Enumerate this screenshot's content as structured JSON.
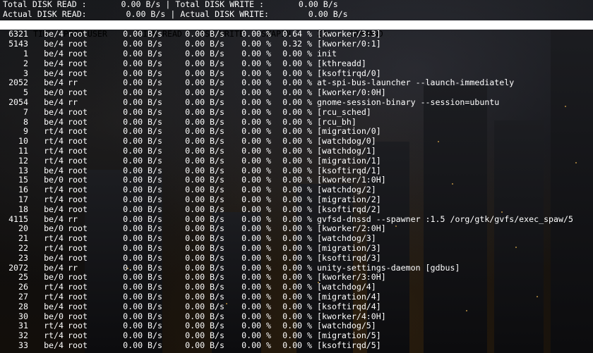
{
  "summary": {
    "total_read_label": "Total DISK READ :",
    "total_read_value": "0.00 B/s",
    "total_write_label": "Total DISK WRITE :",
    "total_write_value": "0.00 B/s",
    "actual_read_label": "Actual DISK READ:",
    "actual_read_value": "0.00 B/s",
    "actual_write_label": "Actual DISK WRITE:",
    "actual_write_value": "0.00 B/s",
    "separator": "|"
  },
  "columns": {
    "tid": "TID",
    "prio": "PRIO",
    "user": "USER",
    "disk_read": "DISK READ",
    "disk_write": "DISK WRITE",
    "swapin": "SWAPIN",
    "io": "IO>",
    "command": "COMMAND"
  },
  "rows": [
    {
      "tid": "6321",
      "prio": "be/4",
      "user": "root",
      "read": "0.00 B/s",
      "write": "0.00 B/s",
      "swapin": "0.00 %",
      "io": "0.64 %",
      "command": "[kworker/3:3]"
    },
    {
      "tid": "5143",
      "prio": "be/4",
      "user": "root",
      "read": "0.00 B/s",
      "write": "0.00 B/s",
      "swapin": "0.00 %",
      "io": "0.32 %",
      "command": "[kworker/0:1]"
    },
    {
      "tid": "1",
      "prio": "be/4",
      "user": "root",
      "read": "0.00 B/s",
      "write": "0.00 B/s",
      "swapin": "0.00 %",
      "io": "0.00 %",
      "command": "init"
    },
    {
      "tid": "2",
      "prio": "be/4",
      "user": "root",
      "read": "0.00 B/s",
      "write": "0.00 B/s",
      "swapin": "0.00 %",
      "io": "0.00 %",
      "command": "[kthreadd]"
    },
    {
      "tid": "3",
      "prio": "be/4",
      "user": "root",
      "read": "0.00 B/s",
      "write": "0.00 B/s",
      "swapin": "0.00 %",
      "io": "0.00 %",
      "command": "[ksoftirqd/0]"
    },
    {
      "tid": "2052",
      "prio": "be/4",
      "user": "rr",
      "read": "0.00 B/s",
      "write": "0.00 B/s",
      "swapin": "0.00 %",
      "io": "0.00 %",
      "command": "at-spi-bus-launcher --launch-immediately"
    },
    {
      "tid": "5",
      "prio": "be/0",
      "user": "root",
      "read": "0.00 B/s",
      "write": "0.00 B/s",
      "swapin": "0.00 %",
      "io": "0.00 %",
      "command": "[kworker/0:0H]"
    },
    {
      "tid": "2054",
      "prio": "be/4",
      "user": "rr",
      "read": "0.00 B/s",
      "write": "0.00 B/s",
      "swapin": "0.00 %",
      "io": "0.00 %",
      "command": "gnome-session-binary --session=ubuntu"
    },
    {
      "tid": "7",
      "prio": "be/4",
      "user": "root",
      "read": "0.00 B/s",
      "write": "0.00 B/s",
      "swapin": "0.00 %",
      "io": "0.00 %",
      "command": "[rcu_sched]"
    },
    {
      "tid": "8",
      "prio": "be/4",
      "user": "root",
      "read": "0.00 B/s",
      "write": "0.00 B/s",
      "swapin": "0.00 %",
      "io": "0.00 %",
      "command": "[rcu_bh]"
    },
    {
      "tid": "9",
      "prio": "rt/4",
      "user": "root",
      "read": "0.00 B/s",
      "write": "0.00 B/s",
      "swapin": "0.00 %",
      "io": "0.00 %",
      "command": "[migration/0]"
    },
    {
      "tid": "10",
      "prio": "rt/4",
      "user": "root",
      "read": "0.00 B/s",
      "write": "0.00 B/s",
      "swapin": "0.00 %",
      "io": "0.00 %",
      "command": "[watchdog/0]"
    },
    {
      "tid": "11",
      "prio": "rt/4",
      "user": "root",
      "read": "0.00 B/s",
      "write": "0.00 B/s",
      "swapin": "0.00 %",
      "io": "0.00 %",
      "command": "[watchdog/1]"
    },
    {
      "tid": "12",
      "prio": "rt/4",
      "user": "root",
      "read": "0.00 B/s",
      "write": "0.00 B/s",
      "swapin": "0.00 %",
      "io": "0.00 %",
      "command": "[migration/1]"
    },
    {
      "tid": "13",
      "prio": "be/4",
      "user": "root",
      "read": "0.00 B/s",
      "write": "0.00 B/s",
      "swapin": "0.00 %",
      "io": "0.00 %",
      "command": "[ksoftirqd/1]"
    },
    {
      "tid": "15",
      "prio": "be/0",
      "user": "root",
      "read": "0.00 B/s",
      "write": "0.00 B/s",
      "swapin": "0.00 %",
      "io": "0.00 %",
      "command": "[kworker/1:0H]"
    },
    {
      "tid": "16",
      "prio": "rt/4",
      "user": "root",
      "read": "0.00 B/s",
      "write": "0.00 B/s",
      "swapin": "0.00 %",
      "io": "0.00 %",
      "command": "[watchdog/2]"
    },
    {
      "tid": "17",
      "prio": "rt/4",
      "user": "root",
      "read": "0.00 B/s",
      "write": "0.00 B/s",
      "swapin": "0.00 %",
      "io": "0.00 %",
      "command": "[migration/2]"
    },
    {
      "tid": "18",
      "prio": "be/4",
      "user": "root",
      "read": "0.00 B/s",
      "write": "0.00 B/s",
      "swapin": "0.00 %",
      "io": "0.00 %",
      "command": "[ksoftirqd/2]"
    },
    {
      "tid": "4115",
      "prio": "be/4",
      "user": "rr",
      "read": "0.00 B/s",
      "write": "0.00 B/s",
      "swapin": "0.00 %",
      "io": "0.00 %",
      "command": "gvfsd-dnssd --spawner :1.5 /org/gtk/gvfs/exec_spaw/5"
    },
    {
      "tid": "20",
      "prio": "be/0",
      "user": "root",
      "read": "0.00 B/s",
      "write": "0.00 B/s",
      "swapin": "0.00 %",
      "io": "0.00 %",
      "command": "[kworker/2:0H]"
    },
    {
      "tid": "21",
      "prio": "rt/4",
      "user": "root",
      "read": "0.00 B/s",
      "write": "0.00 B/s",
      "swapin": "0.00 %",
      "io": "0.00 %",
      "command": "[watchdog/3]"
    },
    {
      "tid": "22",
      "prio": "rt/4",
      "user": "root",
      "read": "0.00 B/s",
      "write": "0.00 B/s",
      "swapin": "0.00 %",
      "io": "0.00 %",
      "command": "[migration/3]"
    },
    {
      "tid": "23",
      "prio": "be/4",
      "user": "root",
      "read": "0.00 B/s",
      "write": "0.00 B/s",
      "swapin": "0.00 %",
      "io": "0.00 %",
      "command": "[ksoftirqd/3]"
    },
    {
      "tid": "2072",
      "prio": "be/4",
      "user": "rr",
      "read": "0.00 B/s",
      "write": "0.00 B/s",
      "swapin": "0.00 %",
      "io": "0.00 %",
      "command": "unity-settings-daemon [gdbus]"
    },
    {
      "tid": "25",
      "prio": "be/0",
      "user": "root",
      "read": "0.00 B/s",
      "write": "0.00 B/s",
      "swapin": "0.00 %",
      "io": "0.00 %",
      "command": "[kworker/3:0H]"
    },
    {
      "tid": "26",
      "prio": "rt/4",
      "user": "root",
      "read": "0.00 B/s",
      "write": "0.00 B/s",
      "swapin": "0.00 %",
      "io": "0.00 %",
      "command": "[watchdog/4]"
    },
    {
      "tid": "27",
      "prio": "rt/4",
      "user": "root",
      "read": "0.00 B/s",
      "write": "0.00 B/s",
      "swapin": "0.00 %",
      "io": "0.00 %",
      "command": "[migration/4]"
    },
    {
      "tid": "28",
      "prio": "be/4",
      "user": "root",
      "read": "0.00 B/s",
      "write": "0.00 B/s",
      "swapin": "0.00 %",
      "io": "0.00 %",
      "command": "[ksoftirqd/4]"
    },
    {
      "tid": "30",
      "prio": "be/0",
      "user": "root",
      "read": "0.00 B/s",
      "write": "0.00 B/s",
      "swapin": "0.00 %",
      "io": "0.00 %",
      "command": "[kworker/4:0H]"
    },
    {
      "tid": "31",
      "prio": "rt/4",
      "user": "root",
      "read": "0.00 B/s",
      "write": "0.00 B/s",
      "swapin": "0.00 %",
      "io": "0.00 %",
      "command": "[watchdog/5]"
    },
    {
      "tid": "32",
      "prio": "rt/4",
      "user": "root",
      "read": "0.00 B/s",
      "write": "0.00 B/s",
      "swapin": "0.00 %",
      "io": "0.00 %",
      "command": "[migration/5]"
    },
    {
      "tid": "33",
      "prio": "be/4",
      "user": "root",
      "read": "0.00 B/s",
      "write": "0.00 B/s",
      "swapin": "0.00 %",
      "io": "0.00 %",
      "command": "[ksoftirqd/5]"
    }
  ],
  "colors": {
    "foreground": "#ffffff",
    "header_background": "#ffffff",
    "header_foreground": "#000000"
  }
}
